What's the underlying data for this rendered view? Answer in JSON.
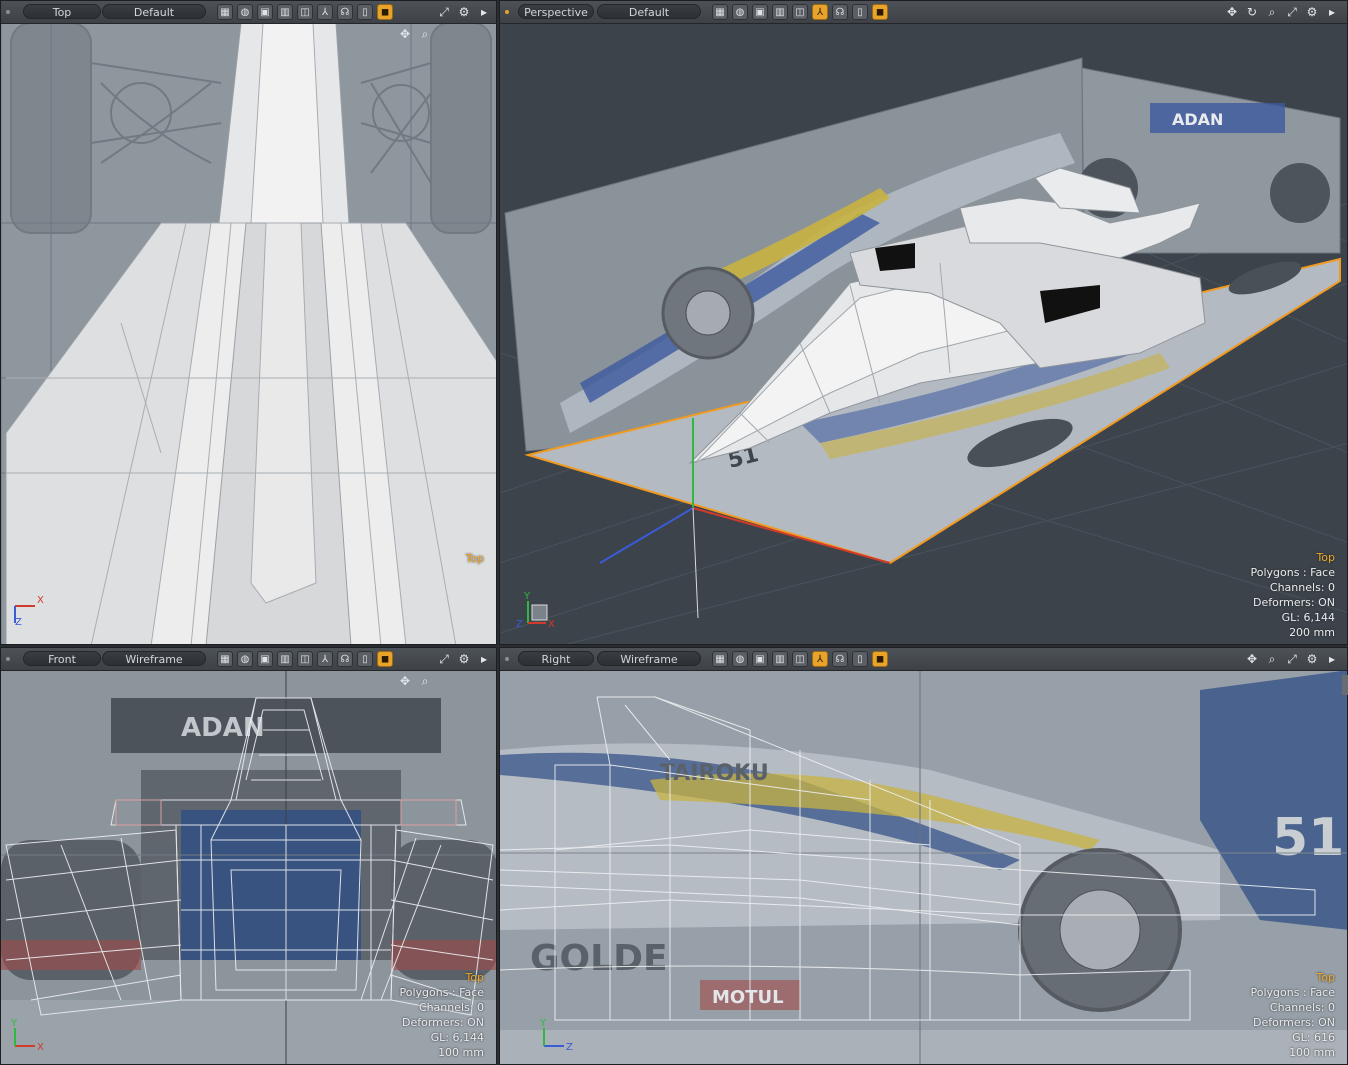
{
  "viewports": {
    "top_left": {
      "view": "Top",
      "style": "Default",
      "overlay": [
        "Top"
      ]
    },
    "top_right": {
      "view": "Perspective",
      "style": "Default",
      "overlay": [
        "Top",
        "Polygons : Face",
        "Channels: 0",
        "Deformers: ON",
        "GL: 6,144",
        "200 mm"
      ]
    },
    "bottom_left": {
      "view": "Front",
      "style": "Wireframe",
      "overlay": [
        "Top",
        "Polygons : Face",
        "Channels: 0",
        "Deformers: ON",
        "GL: 6,144",
        "100 mm"
      ]
    },
    "bottom_right": {
      "view": "Right",
      "style": "Wireframe",
      "overlay": [
        "Top",
        "Polygons : Face",
        "Channels: 0",
        "Deformers: ON",
        "GL: 616",
        "100 mm"
      ]
    }
  },
  "axis_labels": {
    "x": "X",
    "y": "Y",
    "z": "Z"
  },
  "background_text": {
    "sponsor_adan": "ADAN",
    "car_number": "51",
    "sponsor_motul": "MOTUL",
    "sponsor_taiyoku": "TAIROKU",
    "sponsor_golde": "GOLDE"
  },
  "icons": [
    "move-icon",
    "rotate-icon",
    "zoom-icon",
    "maximize-icon",
    "gear-icon",
    "arrow-right-icon"
  ],
  "colors": {
    "accent": "#e8a32a",
    "grid_line": "#5a626b",
    "axis_x": "#d23b2b",
    "axis_y": "#2dbb3f",
    "axis_z": "#3a5bd6",
    "selection": "#f19a22"
  }
}
